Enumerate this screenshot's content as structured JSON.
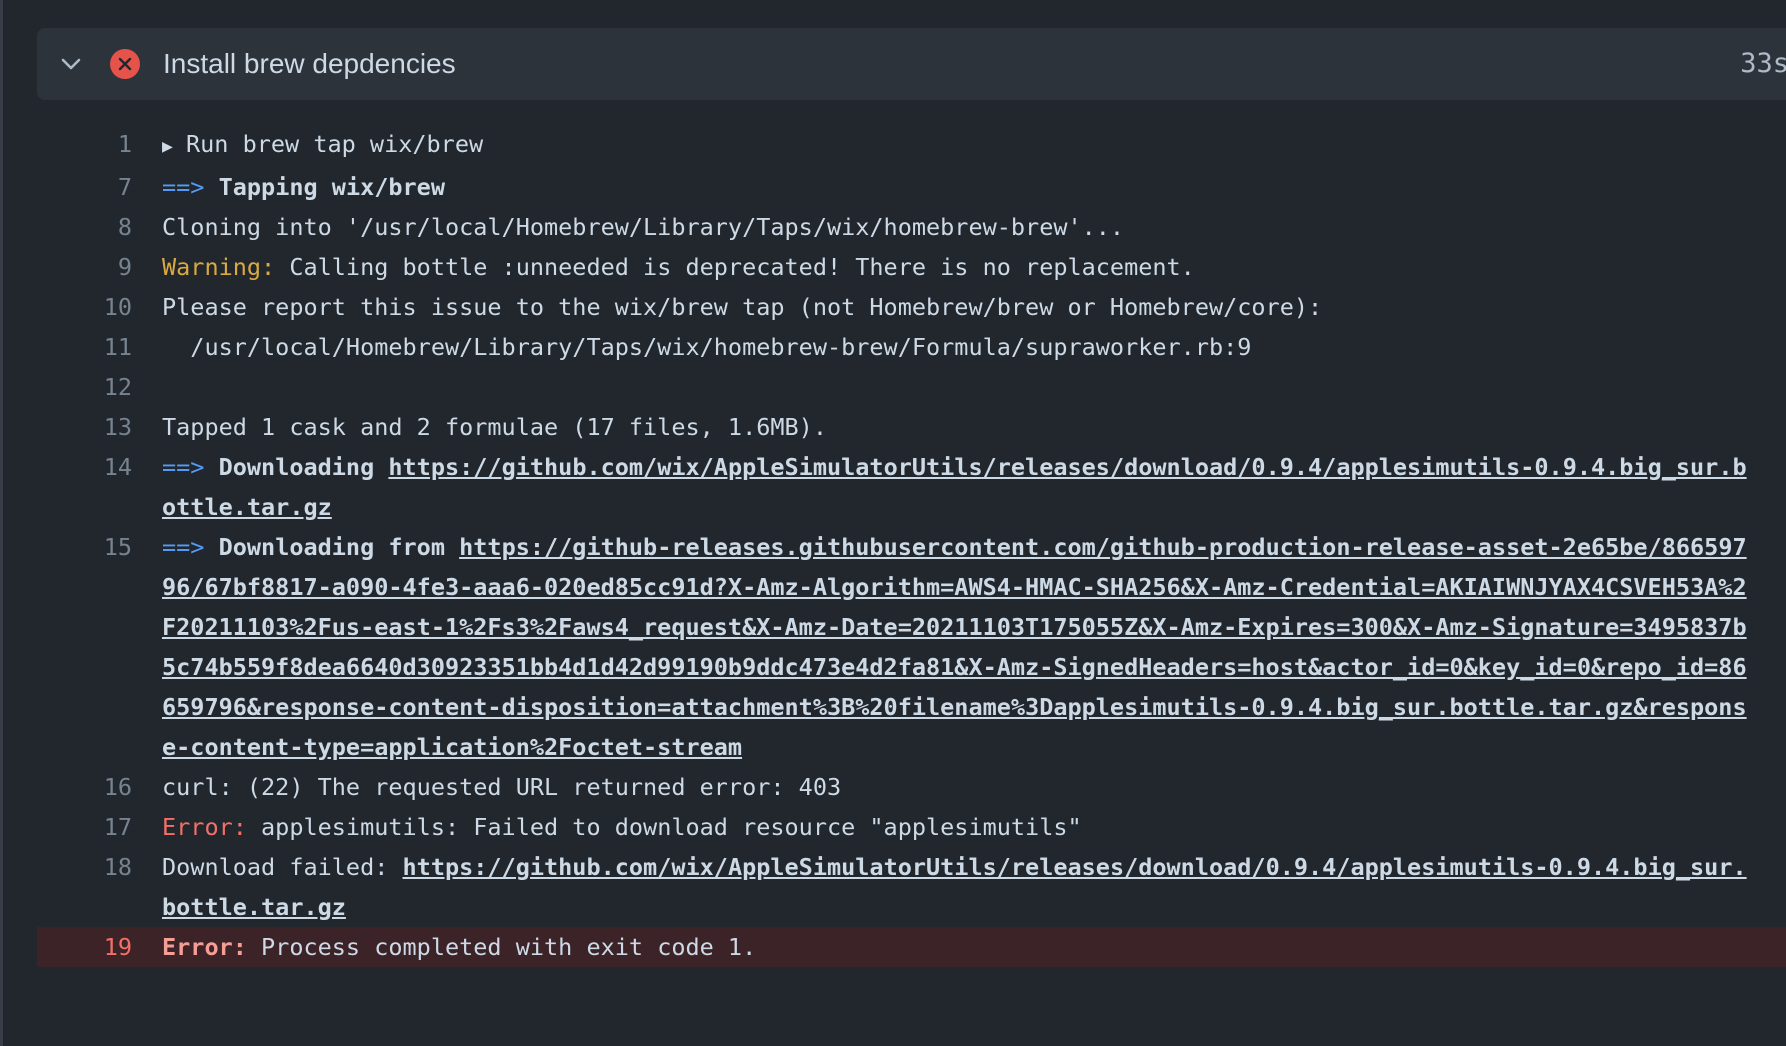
{
  "step": {
    "title": "Install brew depdencies",
    "duration": "33s",
    "status": "failed",
    "status_color": "#e5534b"
  },
  "log": {
    "l1": {
      "num": "1",
      "text": "Run brew tap wix/brew"
    },
    "l7": {
      "num": "7",
      "arrow": "==>",
      "text": "Tapping wix/brew"
    },
    "l8": {
      "num": "8",
      "text": "Cloning into '/usr/local/Homebrew/Library/Taps/wix/homebrew-brew'..."
    },
    "l9": {
      "num": "9",
      "label": "Warning:",
      "text": " Calling bottle :unneeded is deprecated! There is no replacement."
    },
    "l10": {
      "num": "10",
      "text": "Please report this issue to the wix/brew tap (not Homebrew/brew or Homebrew/core):"
    },
    "l11": {
      "num": "11",
      "text": "  /usr/local/Homebrew/Library/Taps/wix/homebrew-brew/Formula/supraworker.rb:9"
    },
    "l12": {
      "num": "12",
      "text": ""
    },
    "l13": {
      "num": "13",
      "text": "Tapped 1 cask and 2 formulae (17 files, 1.6MB)."
    },
    "l14": {
      "num": "14",
      "arrow": "==>",
      "text": " Downloading ",
      "url": "https://github.com/wix/AppleSimulatorUtils/releases/download/0.9.4/applesimutils-0.9.4.big_sur.bottle.tar.gz"
    },
    "l15": {
      "num": "15",
      "arrow": "==>",
      "text": " Downloading from ",
      "url": "https://github-releases.githubusercontent.com/github-production-release-asset-2e65be/86659796/67bf8817-a090-4fe3-aaa6-020ed85cc91d?X-Amz-Algorithm=AWS4-HMAC-SHA256&X-Amz-Credential=AKIAIWNJYAX4CSVEH53A%2F20211103%2Fus-east-1%2Fs3%2Faws4_request&X-Amz-Date=20211103T175055Z&X-Amz-Expires=300&X-Amz-Signature=3495837b5c74b559f8dea6640d30923351bb4d1d42d99190b9ddc473e4d2fa81&X-Amz-SignedHeaders=host&actor_id=0&key_id=0&repo_id=86659796&response-content-disposition=attachment%3B%20filename%3Dapplesimutils-0.9.4.big_sur.bottle.tar.gz&response-content-type=application%2Foctet-stream"
    },
    "l16": {
      "num": "16",
      "text": "curl: (22) The requested URL returned error: 403"
    },
    "l17": {
      "num": "17",
      "label": "Error:",
      "text": " applesimutils: Failed to download resource \"applesimutils\""
    },
    "l18": {
      "num": "18",
      "text": "Download failed: ",
      "url": "https://github.com/wix/AppleSimulatorUtils/releases/download/0.9.4/applesimutils-0.9.4.big_sur.bottle.tar.gz"
    },
    "l19": {
      "num": "19",
      "label": "Error:",
      "text": " Process completed with exit code 1."
    }
  }
}
